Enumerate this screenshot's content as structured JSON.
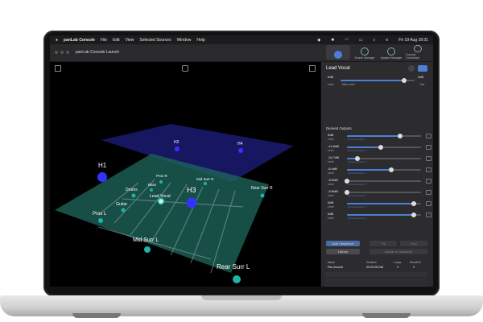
{
  "menubar": {
    "apple": "",
    "app_name": "panLab Console",
    "menus": [
      "File",
      "Edit",
      "View",
      "Selected Sources",
      "Window",
      "Help"
    ],
    "clock": "Fri 19 Aug 18:31"
  },
  "window": {
    "title": "panLab Console Launch",
    "tabs": [
      "",
      "Source Manager",
      "Speaker Manager",
      "Console Connection"
    ]
  },
  "scene": {
    "speakers": [
      "H1",
      "H2",
      "H3",
      "H4"
    ],
    "sources": [
      "Pros R",
      "Bass",
      "Mid Surr R",
      "Drums",
      "Lead Vocal",
      "Rear Surr R",
      "Guitar",
      "Pros L",
      "Mid Surr L",
      "Rear Surr L"
    ]
  },
  "panel": {
    "source_name": "Lead Vocal",
    "main": {
      "value": "0dB",
      "value2": "0dB",
      "label_left": "Level",
      "label_mid": "Main Level",
      "label_right": "Trim",
      "level": 0.86
    },
    "derived_title": "Derived Outputs",
    "outputs": [
      {
        "value": "0dB",
        "sub": "Level",
        "name": "Derived Output 1",
        "level": 0.72
      },
      {
        "value": "-14.6dB",
        "sub": "Level",
        "name": "Derived Output 2",
        "level": 0.46
      },
      {
        "value": "-24.7dB",
        "sub": "Level",
        "name": "Derived Output 3",
        "level": 0.14
      },
      {
        "value": "-8.4dB",
        "sub": "Level",
        "name": "Derived Output 4",
        "level": 0.6
      },
      {
        "value": "-100dB",
        "sub": "Level",
        "name": "Derived Output 5",
        "level": 0.0
      },
      {
        "value": "-100dB",
        "sub": "Level",
        "name": "Derived Output 6",
        "level": 0.0
      },
      {
        "value": "0dB",
        "sub": "Level",
        "name": "Derived Output 7",
        "level": 0.9
      },
      {
        "value": "0dB",
        "sub": "Level",
        "name": "Derived Output 8",
        "level": 0.9
      }
    ],
    "buttons": {
      "add_sequence": "Add Sequence",
      "fill": "Fill",
      "stop": "Stop",
      "library": "Library",
      "assign": "Assign to Snapshot"
    },
    "table": {
      "headers": [
        "Name",
        "Duration",
        "Loops",
        "Recall ID"
      ],
      "rows": [
        {
          "name": "Pan Around",
          "duration": "00:00:08.248",
          "loops": "0",
          "recall": "0"
        }
      ]
    }
  },
  "colors": {
    "accent": "#4c7fd6",
    "speaker": "#2a2ad8",
    "source": "#1fb3a8",
    "floor": "#1f6a5e",
    "ceiling": "#2b2ba6"
  }
}
